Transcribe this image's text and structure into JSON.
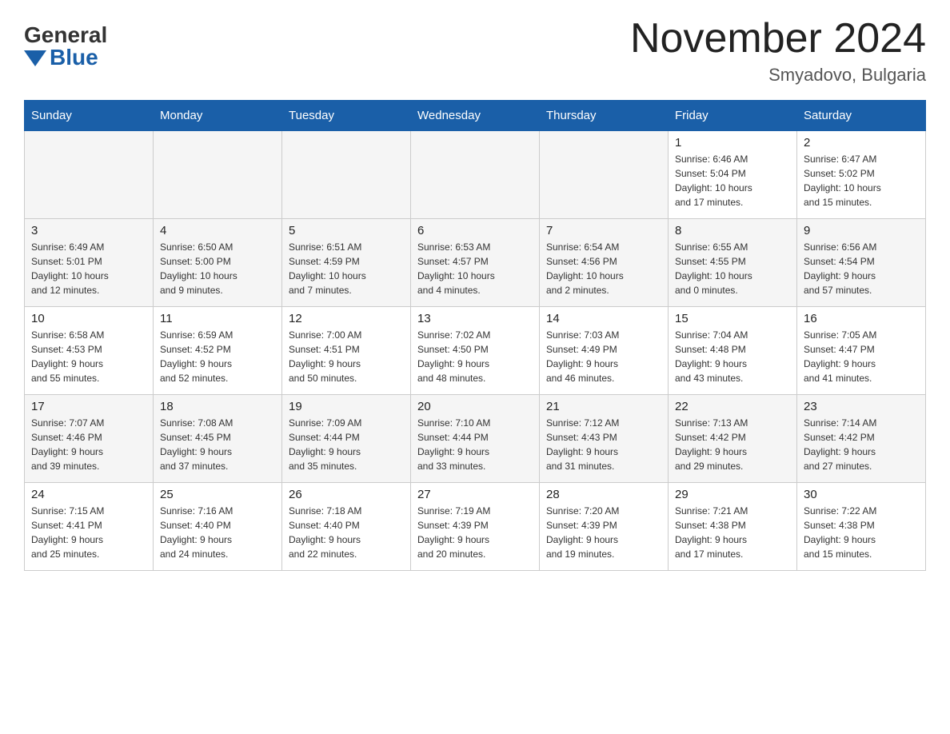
{
  "header": {
    "logo_general": "General",
    "logo_blue": "Blue",
    "month_title": "November 2024",
    "location": "Smyadovo, Bulgaria"
  },
  "days_of_week": [
    "Sunday",
    "Monday",
    "Tuesday",
    "Wednesday",
    "Thursday",
    "Friday",
    "Saturday"
  ],
  "weeks": [
    [
      {
        "day": "",
        "info": ""
      },
      {
        "day": "",
        "info": ""
      },
      {
        "day": "",
        "info": ""
      },
      {
        "day": "",
        "info": ""
      },
      {
        "day": "",
        "info": ""
      },
      {
        "day": "1",
        "info": "Sunrise: 6:46 AM\nSunset: 5:04 PM\nDaylight: 10 hours\nand 17 minutes."
      },
      {
        "day": "2",
        "info": "Sunrise: 6:47 AM\nSunset: 5:02 PM\nDaylight: 10 hours\nand 15 minutes."
      }
    ],
    [
      {
        "day": "3",
        "info": "Sunrise: 6:49 AM\nSunset: 5:01 PM\nDaylight: 10 hours\nand 12 minutes."
      },
      {
        "day": "4",
        "info": "Sunrise: 6:50 AM\nSunset: 5:00 PM\nDaylight: 10 hours\nand 9 minutes."
      },
      {
        "day": "5",
        "info": "Sunrise: 6:51 AM\nSunset: 4:59 PM\nDaylight: 10 hours\nand 7 minutes."
      },
      {
        "day": "6",
        "info": "Sunrise: 6:53 AM\nSunset: 4:57 PM\nDaylight: 10 hours\nand 4 minutes."
      },
      {
        "day": "7",
        "info": "Sunrise: 6:54 AM\nSunset: 4:56 PM\nDaylight: 10 hours\nand 2 minutes."
      },
      {
        "day": "8",
        "info": "Sunrise: 6:55 AM\nSunset: 4:55 PM\nDaylight: 10 hours\nand 0 minutes."
      },
      {
        "day": "9",
        "info": "Sunrise: 6:56 AM\nSunset: 4:54 PM\nDaylight: 9 hours\nand 57 minutes."
      }
    ],
    [
      {
        "day": "10",
        "info": "Sunrise: 6:58 AM\nSunset: 4:53 PM\nDaylight: 9 hours\nand 55 minutes."
      },
      {
        "day": "11",
        "info": "Sunrise: 6:59 AM\nSunset: 4:52 PM\nDaylight: 9 hours\nand 52 minutes."
      },
      {
        "day": "12",
        "info": "Sunrise: 7:00 AM\nSunset: 4:51 PM\nDaylight: 9 hours\nand 50 minutes."
      },
      {
        "day": "13",
        "info": "Sunrise: 7:02 AM\nSunset: 4:50 PM\nDaylight: 9 hours\nand 48 minutes."
      },
      {
        "day": "14",
        "info": "Sunrise: 7:03 AM\nSunset: 4:49 PM\nDaylight: 9 hours\nand 46 minutes."
      },
      {
        "day": "15",
        "info": "Sunrise: 7:04 AM\nSunset: 4:48 PM\nDaylight: 9 hours\nand 43 minutes."
      },
      {
        "day": "16",
        "info": "Sunrise: 7:05 AM\nSunset: 4:47 PM\nDaylight: 9 hours\nand 41 minutes."
      }
    ],
    [
      {
        "day": "17",
        "info": "Sunrise: 7:07 AM\nSunset: 4:46 PM\nDaylight: 9 hours\nand 39 minutes."
      },
      {
        "day": "18",
        "info": "Sunrise: 7:08 AM\nSunset: 4:45 PM\nDaylight: 9 hours\nand 37 minutes."
      },
      {
        "day": "19",
        "info": "Sunrise: 7:09 AM\nSunset: 4:44 PM\nDaylight: 9 hours\nand 35 minutes."
      },
      {
        "day": "20",
        "info": "Sunrise: 7:10 AM\nSunset: 4:44 PM\nDaylight: 9 hours\nand 33 minutes."
      },
      {
        "day": "21",
        "info": "Sunrise: 7:12 AM\nSunset: 4:43 PM\nDaylight: 9 hours\nand 31 minutes."
      },
      {
        "day": "22",
        "info": "Sunrise: 7:13 AM\nSunset: 4:42 PM\nDaylight: 9 hours\nand 29 minutes."
      },
      {
        "day": "23",
        "info": "Sunrise: 7:14 AM\nSunset: 4:42 PM\nDaylight: 9 hours\nand 27 minutes."
      }
    ],
    [
      {
        "day": "24",
        "info": "Sunrise: 7:15 AM\nSunset: 4:41 PM\nDaylight: 9 hours\nand 25 minutes."
      },
      {
        "day": "25",
        "info": "Sunrise: 7:16 AM\nSunset: 4:40 PM\nDaylight: 9 hours\nand 24 minutes."
      },
      {
        "day": "26",
        "info": "Sunrise: 7:18 AM\nSunset: 4:40 PM\nDaylight: 9 hours\nand 22 minutes."
      },
      {
        "day": "27",
        "info": "Sunrise: 7:19 AM\nSunset: 4:39 PM\nDaylight: 9 hours\nand 20 minutes."
      },
      {
        "day": "28",
        "info": "Sunrise: 7:20 AM\nSunset: 4:39 PM\nDaylight: 9 hours\nand 19 minutes."
      },
      {
        "day": "29",
        "info": "Sunrise: 7:21 AM\nSunset: 4:38 PM\nDaylight: 9 hours\nand 17 minutes."
      },
      {
        "day": "30",
        "info": "Sunrise: 7:22 AM\nSunset: 4:38 PM\nDaylight: 9 hours\nand 15 minutes."
      }
    ]
  ]
}
